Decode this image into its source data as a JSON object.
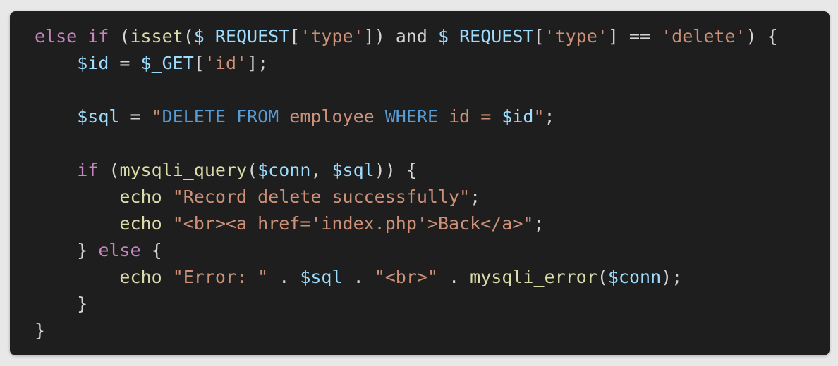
{
  "colors": {
    "background": "#1e1e1e",
    "page": "#e8e8e8",
    "plain": "#d4d4d4",
    "keyword": "#c586c0",
    "function": "#dcdcaa",
    "variable": "#9cdcfe",
    "string": "#ce9178",
    "sql_keyword": "#569cd6"
  },
  "code": {
    "lines": [
      [
        {
          "t": "else if",
          "c": "keyword"
        },
        {
          "t": " (",
          "c": "plain"
        },
        {
          "t": "isset",
          "c": "function"
        },
        {
          "t": "(",
          "c": "plain"
        },
        {
          "t": "$_REQUEST",
          "c": "variable"
        },
        {
          "t": "[",
          "c": "plain"
        },
        {
          "t": "'type'",
          "c": "string"
        },
        {
          "t": "]) and ",
          "c": "plain"
        },
        {
          "t": "$_REQUEST",
          "c": "variable"
        },
        {
          "t": "[",
          "c": "plain"
        },
        {
          "t": "'type'",
          "c": "string"
        },
        {
          "t": "] == ",
          "c": "plain"
        },
        {
          "t": "'delete'",
          "c": "string"
        },
        {
          "t": ") {",
          "c": "plain"
        }
      ],
      [
        {
          "t": "    ",
          "c": "plain"
        },
        {
          "t": "$id",
          "c": "variable"
        },
        {
          "t": " = ",
          "c": "plain"
        },
        {
          "t": "$_GET",
          "c": "variable"
        },
        {
          "t": "[",
          "c": "plain"
        },
        {
          "t": "'id'",
          "c": "string"
        },
        {
          "t": "];",
          "c": "plain"
        }
      ],
      [],
      [
        {
          "t": "    ",
          "c": "plain"
        },
        {
          "t": "$sql",
          "c": "variable"
        },
        {
          "t": " = ",
          "c": "plain"
        },
        {
          "t": "\"",
          "c": "string"
        },
        {
          "t": "DELETE FROM",
          "c": "sql_keyword"
        },
        {
          "t": " employee ",
          "c": "string"
        },
        {
          "t": "WHERE",
          "c": "sql_keyword"
        },
        {
          "t": " id = ",
          "c": "string"
        },
        {
          "t": "$id",
          "c": "variable"
        },
        {
          "t": "\"",
          "c": "string"
        },
        {
          "t": ";",
          "c": "plain"
        }
      ],
      [],
      [
        {
          "t": "    ",
          "c": "plain"
        },
        {
          "t": "if",
          "c": "keyword"
        },
        {
          "t": " (",
          "c": "plain"
        },
        {
          "t": "mysqli_query",
          "c": "function"
        },
        {
          "t": "(",
          "c": "plain"
        },
        {
          "t": "$conn",
          "c": "variable"
        },
        {
          "t": ", ",
          "c": "plain"
        },
        {
          "t": "$sql",
          "c": "variable"
        },
        {
          "t": ")) {",
          "c": "plain"
        }
      ],
      [
        {
          "t": "        ",
          "c": "plain"
        },
        {
          "t": "echo",
          "c": "function"
        },
        {
          "t": " ",
          "c": "plain"
        },
        {
          "t": "\"Record delete successfully\"",
          "c": "string"
        },
        {
          "t": ";",
          "c": "plain"
        }
      ],
      [
        {
          "t": "        ",
          "c": "plain"
        },
        {
          "t": "echo",
          "c": "function"
        },
        {
          "t": " ",
          "c": "plain"
        },
        {
          "t": "\"<br><a href='index.php'>Back</a>\"",
          "c": "string"
        },
        {
          "t": ";",
          "c": "plain"
        }
      ],
      [
        {
          "t": "    } ",
          "c": "plain"
        },
        {
          "t": "else",
          "c": "keyword"
        },
        {
          "t": " {",
          "c": "plain"
        }
      ],
      [
        {
          "t": "        ",
          "c": "plain"
        },
        {
          "t": "echo",
          "c": "function"
        },
        {
          "t": " ",
          "c": "plain"
        },
        {
          "t": "\"Error: \"",
          "c": "string"
        },
        {
          "t": " . ",
          "c": "plain"
        },
        {
          "t": "$sql",
          "c": "variable"
        },
        {
          "t": " . ",
          "c": "plain"
        },
        {
          "t": "\"<br>\"",
          "c": "string"
        },
        {
          "t": " . ",
          "c": "plain"
        },
        {
          "t": "mysqli_error",
          "c": "function"
        },
        {
          "t": "(",
          "c": "plain"
        },
        {
          "t": "$conn",
          "c": "variable"
        },
        {
          "t": ");",
          "c": "plain"
        }
      ],
      [
        {
          "t": "    }",
          "c": "plain"
        }
      ],
      [
        {
          "t": "}",
          "c": "plain"
        }
      ]
    ]
  }
}
